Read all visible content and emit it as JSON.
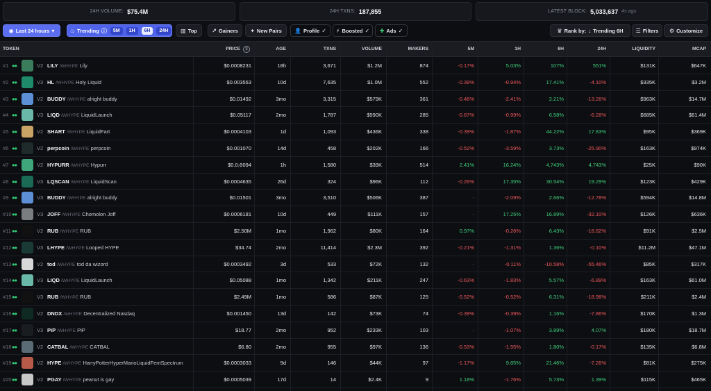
{
  "stats": [
    {
      "label": "24H VOLUME:",
      "value": "$75.4M",
      "extra": ""
    },
    {
      "label": "24H TXNS:",
      "value": "187,855",
      "extra": ""
    },
    {
      "label": "LATEST BLOCK:",
      "value": "5,033,637",
      "extra": "4s ago"
    }
  ],
  "toolbar": {
    "time_filter": "Last 24 hours",
    "trending": "Trending",
    "trend_segments": [
      "5M",
      "1H",
      "6H",
      "24H"
    ],
    "active_segment": "6H",
    "top": "Top",
    "gainers": "Gainers",
    "new_pairs": "New Pairs",
    "profile": "Profile",
    "boosted": "Boosted",
    "ads": "Ads",
    "rank_by": "Rank by:",
    "rank_value": "Trending 6H",
    "filters": "Filters",
    "customize": "Customize"
  },
  "headers": {
    "token": "TOKEN",
    "price": "PRICE",
    "age": "AGE",
    "txns": "TXNS",
    "volume": "VOLUME",
    "makers": "MAKERS",
    "m5": "5M",
    "h1": "1H",
    "h6": "6H",
    "h24": "24H",
    "liquidity": "LIQUIDITY",
    "mcap": "MCAP"
  },
  "rows": [
    {
      "rank": "#1",
      "ver": "V2",
      "sym": "LILY",
      "quote": "/WHYPE",
      "name": "Lily",
      "price": "$0.0008231",
      "age": "18h",
      "txns": "3,671",
      "volume": "$1.2M",
      "makers": "874",
      "m5": "-0.17%",
      "h1": "5.03%",
      "h6": "107%",
      "h24": "551%",
      "liq": "$131K",
      "mcap": "$647K",
      "color": "#3a7d5c"
    },
    {
      "rank": "#2",
      "ver": "V3",
      "sym": "HL",
      "quote": "/WHYPE",
      "name": "Holy Liquid",
      "price": "$0.003553",
      "age": "10d",
      "txns": "7,635",
      "volume": "$1.0M",
      "makers": "552",
      "m5": "-0.39%",
      "h1": "-0.94%",
      "h6": "17.41%",
      "h24": "-4.10%",
      "liq": "$335K",
      "mcap": "$3.2M",
      "color": "#1e8a6a"
    },
    {
      "rank": "#3",
      "ver": "V2",
      "sym": "BUDDY",
      "quote": "/WHYPE",
      "name": "alright buddy",
      "price": "$0.01492",
      "age": "3mo",
      "txns": "3,315",
      "volume": "$579K",
      "makers": "361",
      "m5": "-0.46%",
      "h1": "-2.41%",
      "h6": "2.21%",
      "h24": "-13.26%",
      "liq": "$963K",
      "mcap": "$14.7M",
      "color": "#5c8fd6"
    },
    {
      "rank": "#4",
      "ver": "V3",
      "sym": "LIQD",
      "quote": "/WHYPE",
      "name": "LiquidLaunch",
      "price": "$0.05117",
      "age": "2mo",
      "txns": "1,787",
      "volume": "$990K",
      "makers": "285",
      "m5": "-0.67%",
      "h1": "-0.99%",
      "h6": "6.58%",
      "h24": "-6.28%",
      "liq": "$685K",
      "mcap": "$61.4M",
      "color": "#6ab8a8"
    },
    {
      "rank": "#5",
      "ver": "V2",
      "sym": "SHART",
      "quote": "/WHYPE",
      "name": "LiquidFart",
      "price": "$0.0004103",
      "age": "1d",
      "txns": "1,093",
      "volume": "$436K",
      "makers": "338",
      "m5": "-0.39%",
      "h1": "-1.87%",
      "h6": "44.22%",
      "h24": "17.83%",
      "liq": "$95K",
      "mcap": "$369K",
      "color": "#c9a266"
    },
    {
      "rank": "#6",
      "ver": "V2",
      "sym": "perpcoin",
      "quote": "/WHYPE",
      "name": "perpcoin",
      "price": "$0.001070",
      "age": "14d",
      "txns": "458",
      "volume": "$202K",
      "makers": "166",
      "m5": "-0.52%",
      "h1": "-3.59%",
      "h6": "3.73%",
      "h24": "-25.90%",
      "liq": "$163K",
      "mcap": "$974K",
      "color": "#1f2a2a"
    },
    {
      "rank": "#7",
      "ver": "V2",
      "sym": "HYPURR",
      "quote": "/WHYPE",
      "name": "Hypurr",
      "price": "$0.0₇9094",
      "age": "1h",
      "txns": "1,580",
      "volume": "$39K",
      "makers": "514",
      "m5": "2.41%",
      "h1": "16.24%",
      "h6": "4,743%",
      "h24": "4,743%",
      "liq": "$25K",
      "mcap": "$90K",
      "color": "#3fa57a"
    },
    {
      "rank": "#8",
      "ver": "V3",
      "sym": "LQSCAN",
      "quote": "/WHYPE",
      "name": "LiquidScan",
      "price": "$0.0004635",
      "age": "26d",
      "txns": "324",
      "volume": "$96K",
      "makers": "112",
      "m5": "-0.26%",
      "h1": "17.35%",
      "h6": "30.54%",
      "h24": "19.29%",
      "liq": "$123K",
      "mcap": "$429K",
      "color": "#1a6a55"
    },
    {
      "rank": "#9",
      "ver": "V3",
      "sym": "BUDDY",
      "quote": "/WHYPE",
      "name": "alright buddy",
      "price": "$0.01501",
      "age": "3mo",
      "txns": "3,510",
      "volume": "$506K",
      "makers": "387",
      "m5": "-",
      "h1": "-2.09%",
      "h6": "2.66%",
      "h24": "-12.78%",
      "liq": "$594K",
      "mcap": "$14.8M",
      "color": "#5c8fd6"
    },
    {
      "rank": "#10",
      "ver": "V3",
      "sym": "JOFF",
      "quote": "/WHYPE",
      "name": "Chomolon Joff",
      "price": "$0.0006181",
      "age": "10d",
      "txns": "449",
      "volume": "$111K",
      "makers": "157",
      "m5": "-",
      "h1": "17.25%",
      "h6": "16.89%",
      "h24": "-32.10%",
      "liq": "$126K",
      "mcap": "$636K",
      "color": "#7a7d80"
    },
    {
      "rank": "#11",
      "ver": "V2",
      "sym": "RUB",
      "quote": "/WHYPE",
      "name": "RUB",
      "price": "$2.50M",
      "age": "1mo",
      "txns": "1,962",
      "volume": "$80K",
      "makers": "164",
      "m5": "0.97%",
      "h1": "-0.26%",
      "h6": "6.43%",
      "h24": "-18.82%",
      "liq": "$91K",
      "mcap": "$2.5M",
      "color": "#111111"
    },
    {
      "rank": "#12",
      "ver": "V3",
      "sym": "LHYPE",
      "quote": "/WHYPE",
      "name": "Looped HYPE",
      "price": "$34.74",
      "age": "2mo",
      "txns": "11,414",
      "volume": "$2.3M",
      "makers": "392",
      "m5": "-0.21%",
      "h1": "-1.31%",
      "h6": "1.36%",
      "h24": "-0.10%",
      "liq": "$11.2M",
      "mcap": "$47.1M",
      "color": "#1a3a36"
    },
    {
      "rank": "#13",
      "ver": "V2",
      "sym": "tod",
      "quote": "/WHYPE",
      "name": "tod da wizord",
      "price": "$0.0003492",
      "age": "3d",
      "txns": "533",
      "volume": "$72K",
      "makers": "132",
      "m5": "-",
      "h1": "-0.11%",
      "h6": "-10.58%",
      "h24": "-55.46%",
      "liq": "$85K",
      "mcap": "$317K",
      "color": "#d8d8d8"
    },
    {
      "rank": "#14",
      "ver": "V3",
      "sym": "LIQD",
      "quote": "/WHYPE",
      "name": "LiquidLaunch",
      "price": "$0.05088",
      "age": "1mo",
      "txns": "1,342",
      "volume": "$211K",
      "makers": "247",
      "m5": "-0.63%",
      "h1": "-1.83%",
      "h6": "5.57%",
      "h24": "-6.89%",
      "liq": "$163K",
      "mcap": "$61.0M",
      "color": "#6ab8a8"
    },
    {
      "rank": "#15",
      "ver": "V3",
      "sym": "RUB",
      "quote": "/WHYPE",
      "name": "RUB",
      "price": "$2.49M",
      "age": "1mo",
      "txns": "586",
      "volume": "$87K",
      "makers": "125",
      "m5": "-0.52%",
      "h1": "-0.52%",
      "h6": "6.31%",
      "h24": "-18.98%",
      "liq": "$211K",
      "mcap": "$2.4M",
      "color": "#111111"
    },
    {
      "rank": "#16",
      "ver": "V2",
      "sym": "DNDX",
      "quote": "/WHYPE",
      "name": "Decentralized Nasdaq",
      "price": "$0.001450",
      "age": "13d",
      "txns": "142",
      "volume": "$73K",
      "makers": "74",
      "m5": "-0.39%",
      "h1": "-0.39%",
      "h6": "1.16%",
      "h24": "-7.86%",
      "liq": "$170K",
      "mcap": "$1.3M",
      "color": "#0f2a22"
    },
    {
      "rank": "#17",
      "ver": "V3",
      "sym": "PiP",
      "quote": "/WHYPE",
      "name": "PiP",
      "price": "$18.77",
      "age": "2mo",
      "txns": "952",
      "volume": "$233K",
      "makers": "103",
      "m5": "-",
      "h1": "-1.07%",
      "h6": "3.89%",
      "h24": "4.07%",
      "liq": "$180K",
      "mcap": "$18.7M",
      "color": "#1a1d20"
    },
    {
      "rank": "#18",
      "ver": "V2",
      "sym": "CATBAL",
      "quote": "/WHYPE",
      "name": "CATBAL",
      "price": "$6.80",
      "age": "2mo",
      "txns": "955",
      "volume": "$97K",
      "makers": "136",
      "m5": "-0.53%",
      "h1": "-1.55%",
      "h6": "1.80%",
      "h24": "-0.17%",
      "liq": "$135K",
      "mcap": "$6.8M",
      "color": "#5a6b75"
    },
    {
      "rank": "#19",
      "ver": "V2",
      "sym": "HYPE",
      "quote": "/WHYPE",
      "name": "HarryPotterHyperMarioLiquidFentSpectrum",
      "price": "$0.0003033",
      "age": "9d",
      "txns": "146",
      "volume": "$44K",
      "makers": "97",
      "m5": "-1.17%",
      "h1": "9.85%",
      "h6": "21.46%",
      "h24": "-7.26%",
      "liq": "$81K",
      "mcap": "$275K",
      "color": "#b85a4a"
    },
    {
      "rank": "#20",
      "ver": "V2",
      "sym": "PGAY",
      "quote": "/WHYPE",
      "name": "peanut is gay",
      "price": "$0.0005039",
      "age": "17d",
      "txns": "14",
      "volume": "$2.4K",
      "makers": "9",
      "m5": "1.18%",
      "h1": "-1.76%",
      "h6": "5.73%",
      "h24": "1.39%",
      "liq": "$115K",
      "mcap": "$465K",
      "color": "#c8c8c8"
    }
  ]
}
